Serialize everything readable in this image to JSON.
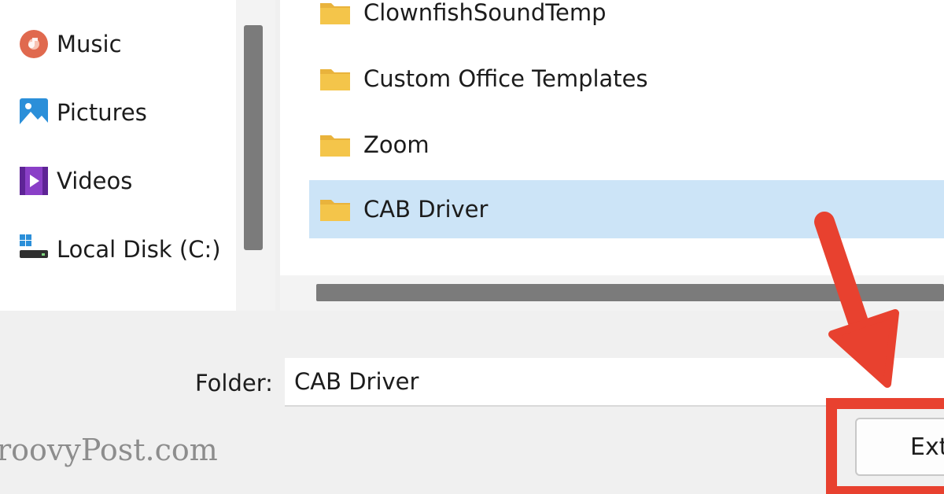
{
  "nav_pane": {
    "items": [
      {
        "label": "Music",
        "icon": "music-icon"
      },
      {
        "label": "Pictures",
        "icon": "pictures-icon"
      },
      {
        "label": "Videos",
        "icon": "videos-icon"
      },
      {
        "label": "Local Disk (C:)",
        "icon": "local-disk-icon"
      }
    ]
  },
  "file_list": {
    "items": [
      {
        "name": "ClownfishSoundTemp",
        "selected": false
      },
      {
        "name": "Custom Office Templates",
        "selected": false
      },
      {
        "name": "Zoom",
        "selected": false
      },
      {
        "name": "CAB Driver",
        "selected": true
      }
    ]
  },
  "folder_field": {
    "label": "Folder:",
    "value": "CAB Driver"
  },
  "extract_button": {
    "label": "Ext"
  },
  "watermark": {
    "text": "roovyPost.com"
  },
  "colors": {
    "selection": "#cce4f7",
    "annotation": "#e8412f",
    "folder": "#f4c54a",
    "scrollbar": "#7b7b7b"
  }
}
